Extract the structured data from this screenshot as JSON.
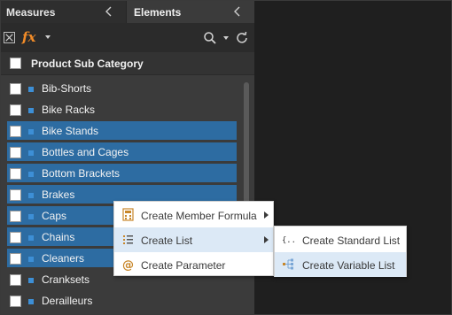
{
  "tabs": [
    {
      "label": "Measures"
    },
    {
      "label": "Elements"
    }
  ],
  "header": {
    "title": "Product Sub Category"
  },
  "items": [
    {
      "label": "Bib-Shorts",
      "selected": false
    },
    {
      "label": "Bike Racks",
      "selected": false
    },
    {
      "label": "Bike Stands",
      "selected": true
    },
    {
      "label": "Bottles and Cages",
      "selected": true
    },
    {
      "label": "Bottom Brackets",
      "selected": true
    },
    {
      "label": "Brakes",
      "selected": true
    },
    {
      "label": "Caps",
      "selected": true
    },
    {
      "label": "Chains",
      "selected": true
    },
    {
      "label": "Cleaners",
      "selected": true
    },
    {
      "label": "Cranksets",
      "selected": false
    },
    {
      "label": "Derailleurs",
      "selected": false
    }
  ],
  "context_menu": {
    "items": [
      {
        "label": "Create Member Formula",
        "icon": "calculator-icon",
        "submenu": true
      },
      {
        "label": "Create List",
        "icon": "list-icon",
        "submenu": true,
        "highlighted": true
      },
      {
        "label": "Create Parameter",
        "icon": "at-sign-icon",
        "submenu": false
      }
    ]
  },
  "submenu": {
    "items": [
      {
        "label": "Create Standard List",
        "icon": "braces-icon"
      },
      {
        "label": "Create Variable List",
        "icon": "hierarchy-icon",
        "highlighted": true
      }
    ]
  },
  "colors": {
    "selection": "#2d6ca2",
    "accent_fx": "#f28c28",
    "item_marker": "#3d8fd6",
    "menu_highlight": "#dce9f6"
  }
}
